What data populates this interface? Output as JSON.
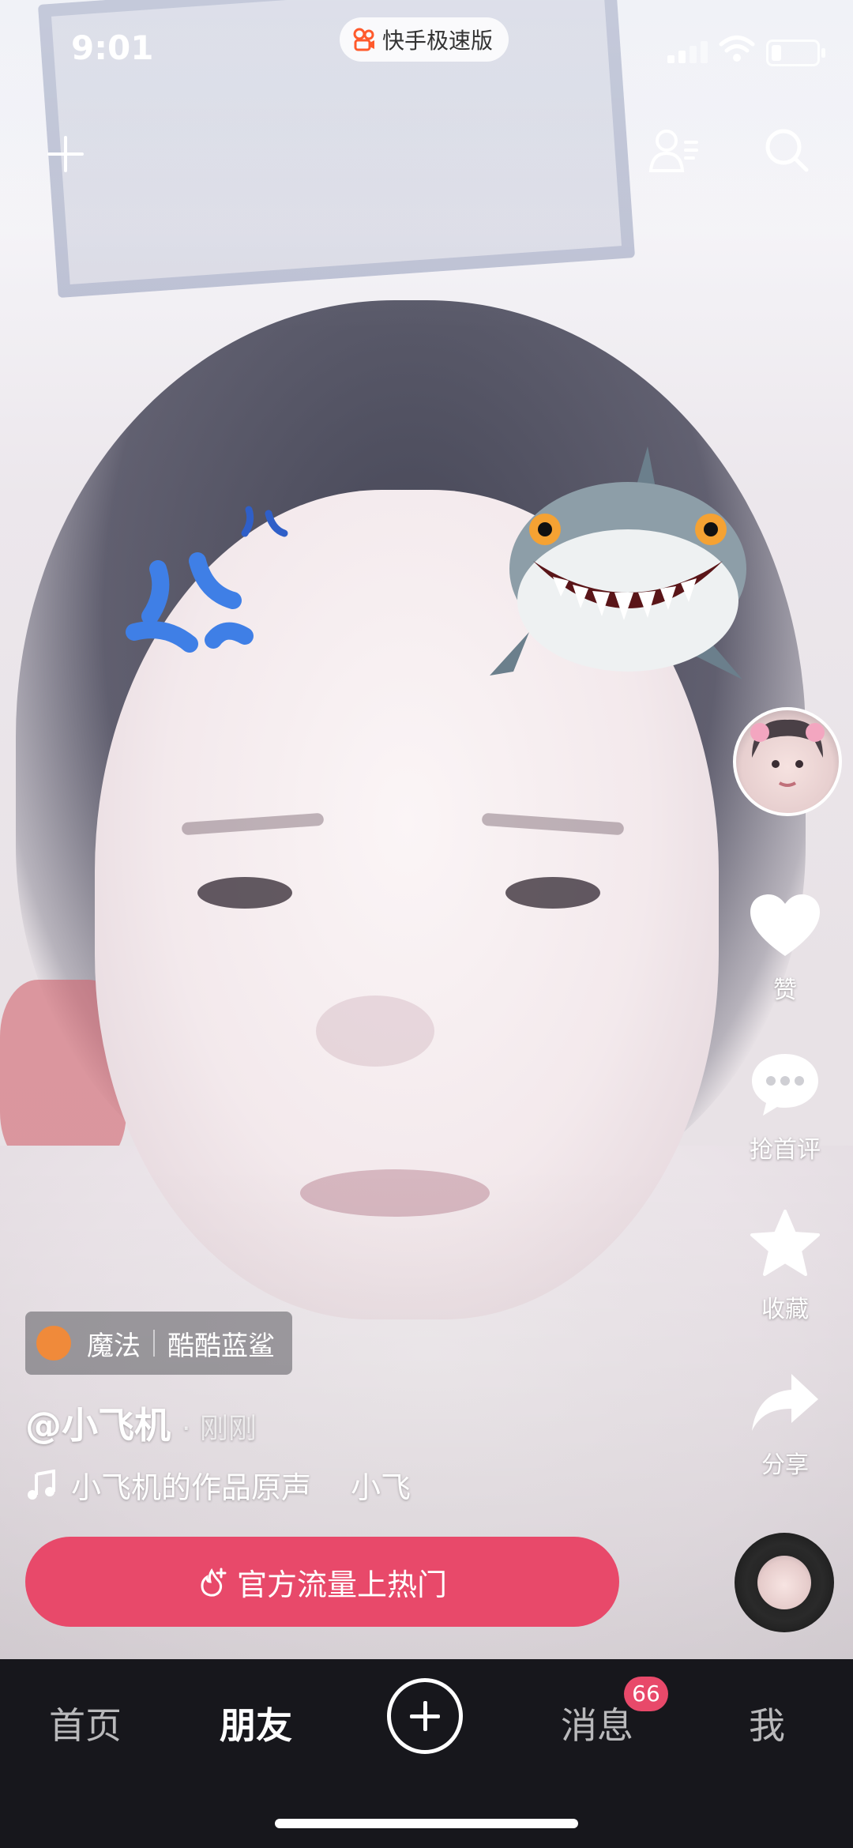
{
  "status_bar": {
    "time": "9:01",
    "app_pill": "快手极速版"
  },
  "top_bar": {
    "add_icon": "plus-icon",
    "contacts_icon": "user-list-icon",
    "search_icon": "search-icon"
  },
  "stickers": [
    "anger-mark-sticker",
    "shark-sticker"
  ],
  "right_rail": {
    "like_label": "赞",
    "comment_label": "抢首评",
    "favorite_label": "收藏",
    "share_label": "分享"
  },
  "video_info": {
    "magic_label": "魔法",
    "magic_name": "酷酷蓝鲨",
    "author": "@小飞机",
    "posted_time": "· 刚刚",
    "music_title": "小飞机的作品原声",
    "music_artist": "小飞",
    "promo_button": "官方流量上热门"
  },
  "tab_bar": {
    "home": "首页",
    "friends": "朋友",
    "messages": "消息",
    "messages_badge": "66",
    "me": "我",
    "active_tab": "朋友"
  },
  "colors": {
    "accent": "#e8496a",
    "tabbar_bg": "#17171c"
  }
}
